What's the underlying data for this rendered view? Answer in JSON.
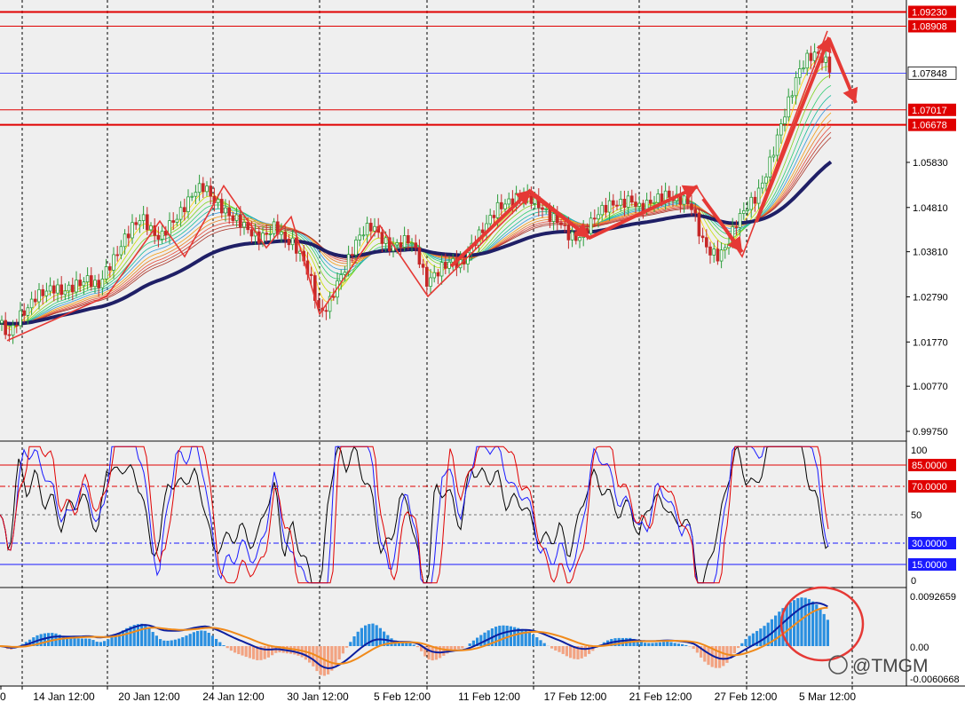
{
  "colors": {
    "background": "#efefef",
    "grid": "#000000",
    "level_red": "#e00000",
    "level_blue": "#1a1aff",
    "current_price": "#1a1aff",
    "bull_candle": "#2a9d3a",
    "bear_candle": "#c62828",
    "ma_slow": "#1f1f66",
    "zigzag": "#e53935",
    "arrow": "#e53935",
    "hist_pos": "#2a8fe0",
    "hist_neg": "#f2a382",
    "macd_line": "#0b1fa0",
    "signal_line": "#f08a1a",
    "stoch_k": "#000000",
    "stoch_d": "#1a1aff",
    "stoch_slow": "#e00000"
  },
  "price_axis": {
    "ticks": [
      "1.05830",
      "1.04810",
      "1.03810",
      "1.02790",
      "1.01770",
      "1.00770",
      "0.99750"
    ],
    "levels": [
      {
        "value": "1.09230",
        "style": "red-box"
      },
      {
        "value": "1.08908",
        "style": "red-box"
      },
      {
        "value": "1.07848",
        "style": "current-price"
      },
      {
        "value": "1.07017",
        "style": "red-box"
      },
      {
        "value": "1.06678",
        "style": "red-box"
      }
    ]
  },
  "oscillator_axis": {
    "ticks": [
      "100",
      "50",
      "0"
    ],
    "levels": [
      {
        "value": "85.0000",
        "color": "#e00000"
      },
      {
        "value": "70.0000",
        "color": "#e00000"
      },
      {
        "value": "30.0000",
        "color": "#1a1aff"
      },
      {
        "value": "15.0000",
        "color": "#1a1aff"
      }
    ]
  },
  "macd_axis": {
    "ticks": [
      "0.0092659",
      "0.00",
      "-0.0060668"
    ]
  },
  "time_axis": {
    "labels": [
      "0",
      "14 Jan 12:00",
      "20 Jan 12:00",
      "24 Jan 12:00",
      "30 Jan 12:00",
      "5 Feb 12:00",
      "11 Feb 12:00",
      "17 Feb 12:00",
      "21 Feb 12:00",
      "27 Feb 12:00",
      "5 Mar 12:00"
    ]
  },
  "watermark": "@TMGM",
  "chart_data": {
    "type": "line",
    "series": [
      {
        "x": [
          0,
          10,
          20,
          30,
          40,
          50,
          60,
          70,
          80,
          90,
          100,
          110,
          120,
          130,
          140,
          150,
          160,
          170,
          180,
          190,
          200,
          210,
          220,
          230,
          240,
          250,
          260,
          270,
          280,
          290,
          300,
          310,
          320,
          330,
          340,
          350,
          360,
          370,
          380,
          390,
          400,
          410,
          420,
          430,
          440,
          450,
          460,
          470,
          480,
          490,
          500,
          510,
          520,
          530,
          540,
          550,
          560,
          570,
          580,
          590,
          600,
          610,
          620,
          630,
          640,
          650,
          660,
          670,
          680,
          690,
          700,
          710,
          720,
          730,
          740,
          750,
          760,
          770,
          780,
          790,
          800,
          810,
          820,
          830,
          840,
          850,
          860,
          870,
          880,
          890,
          900,
          910,
          920,
          930,
          940
        ],
        "values": [
          1.022,
          1.019,
          1.023,
          1.025,
          1.028,
          1.029,
          1.03,
          1.029,
          1.03,
          1.031,
          1.032,
          1.03,
          1.034,
          1.037,
          1.041,
          1.044,
          1.046,
          1.043,
          1.041,
          1.044,
          1.046,
          1.049,
          1.052,
          1.053,
          1.05,
          1.048,
          1.046,
          1.045,
          1.043,
          1.041,
          1.042,
          1.044,
          1.041,
          1.04,
          1.037,
          1.032,
          1.024,
          1.026,
          1.031,
          1.035,
          1.04,
          1.043,
          1.044,
          1.041,
          1.039,
          1.04,
          1.041,
          1.038,
          1.031,
          1.033,
          1.035,
          1.036,
          1.035,
          1.039,
          1.042,
          1.045,
          1.048,
          1.049,
          1.05,
          1.051,
          1.05,
          1.048,
          1.046,
          1.045,
          1.042,
          1.041,
          1.043,
          1.046,
          1.048,
          1.049,
          1.049,
          1.05,
          1.048,
          1.049,
          1.05,
          1.051,
          1.05,
          1.05,
          1.048,
          1.041,
          1.038,
          1.037,
          1.04,
          1.045,
          1.048,
          1.05,
          1.054,
          1.06,
          1.067,
          1.073,
          1.079,
          1.082,
          1.083,
          1.081,
          1.078
        ]
      }
    ],
    "ylim": [
      0.9955,
      1.095
    ]
  }
}
